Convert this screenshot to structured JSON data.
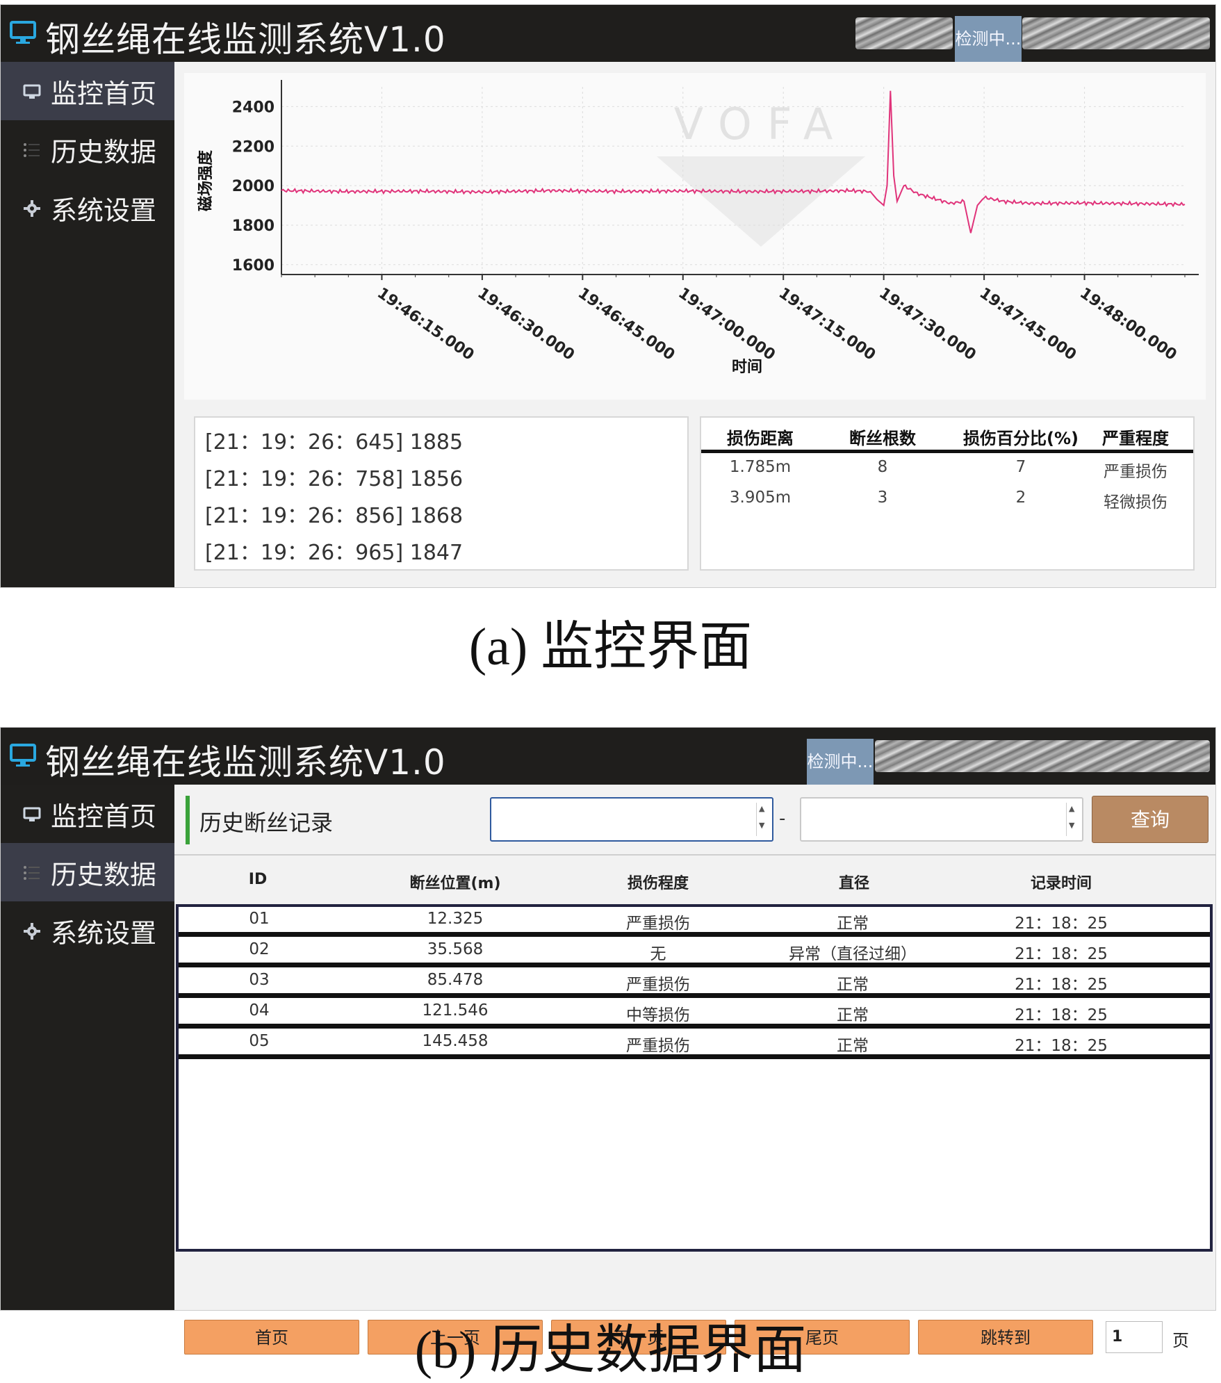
{
  "window_a": {
    "title": "钢丝绳在线监测系统V1.0",
    "status": "检测中...",
    "nav": [
      "监控首页",
      "历史数据",
      "系统设置"
    ],
    "active_nav": 0,
    "log_lines": [
      "[21：19：26：645] 1885",
      "[21：19：26：758] 1856",
      "[21：19：26：856] 1868",
      "[21：19：26：965] 1847"
    ],
    "damage_table": {
      "headers": [
        "损伤距离",
        "断丝根数",
        "损伤百分比(%)",
        "严重程度"
      ],
      "rows": [
        [
          "1.785m",
          "8",
          "7",
          "严重损伤"
        ],
        [
          "3.905m",
          "3",
          "2",
          "轻微损伤"
        ]
      ]
    }
  },
  "chart_data": {
    "type": "line",
    "title": "",
    "xlabel": "时间",
    "ylabel": "磁场强度",
    "ylim": [
      1550,
      2500
    ],
    "yticks": [
      1600,
      1800,
      2000,
      2200,
      2400
    ],
    "xticks": [
      "19:46:15.000",
      "19:46:30.000",
      "19:46:45.000",
      "19:47:00.000",
      "19:47:15.000",
      "19:47:30.000",
      "19:47:45.000",
      "19:48:00.000"
    ],
    "xlim_seconds": [
      0,
      135
    ],
    "series": [
      {
        "color": "#e0337a",
        "x": [
          0,
          10,
          20,
          30,
          40,
          50,
          60,
          70,
          80,
          85,
          88,
          89,
          90,
          90.5,
          91,
          91.5,
          92,
          93,
          95,
          98,
          100,
          102,
          103,
          104,
          105,
          108,
          112,
          120,
          130,
          135
        ],
        "y": [
          1975,
          1970,
          1972,
          1968,
          1975,
          1971,
          1973,
          1970,
          1972,
          1975,
          1970,
          1930,
          1900,
          2000,
          2480,
          2050,
          1920,
          2000,
          1960,
          1930,
          1910,
          1920,
          1760,
          1900,
          1940,
          1920,
          1910,
          1912,
          1908,
          1905
        ]
      }
    ],
    "watermark": "VOFA"
  },
  "window_b": {
    "title": "钢丝绳在线监测系统V1.0",
    "status": "检测中...",
    "nav": [
      "监控首页",
      "历史数据",
      "系统设置"
    ],
    "active_nav": 1,
    "section_title": "历史断丝记录",
    "range_sep": "-",
    "query_button": "查询",
    "columns": [
      "ID",
      "断丝位置(m)",
      "损伤程度",
      "直径",
      "记录时间"
    ],
    "rows": [
      [
        "01",
        "12.325",
        "严重损伤",
        "正常",
        "21：18：25"
      ],
      [
        "02",
        "35.568",
        "无",
        "异常（直径过细）",
        "21：18：25"
      ],
      [
        "03",
        "85.478",
        "严重损伤",
        "正常",
        "21：18：25"
      ],
      [
        "04",
        "121.546",
        "中等损伤",
        "正常",
        "21：18：25"
      ],
      [
        "05",
        "145.458",
        "严重损伤",
        "正常",
        "21：18：25"
      ]
    ],
    "pager": {
      "first": "首页",
      "prev": "上一页",
      "next": "下一页",
      "last": "尾页",
      "jump": "跳转到",
      "page_value": "1",
      "page_suffix": "页"
    }
  },
  "captions": {
    "a": "(a)  监控界面",
    "b": "(b)  历史数据界面"
  }
}
